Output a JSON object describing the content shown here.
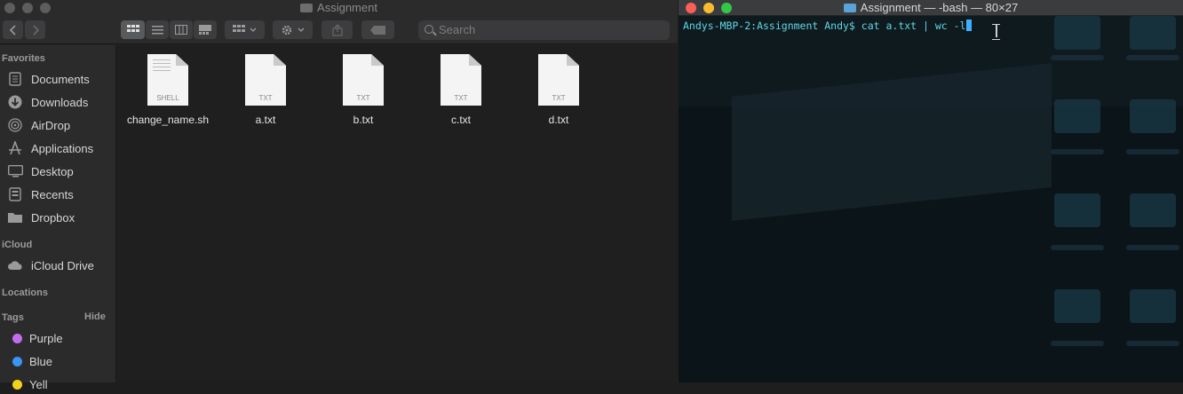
{
  "finder": {
    "title": "Assignment",
    "search_placeholder": "Search",
    "sidebar": {
      "favorites_label": "Favorites",
      "favorites": [
        {
          "label": "Documents",
          "icon": "documents-icon"
        },
        {
          "label": "Downloads",
          "icon": "downloads-icon"
        },
        {
          "label": "AirDrop",
          "icon": "airdrop-icon"
        },
        {
          "label": "Applications",
          "icon": "applications-icon"
        },
        {
          "label": "Desktop",
          "icon": "desktop-icon"
        },
        {
          "label": "Recents",
          "icon": "recents-icon"
        },
        {
          "label": "Dropbox",
          "icon": "dropbox-folder-icon"
        }
      ],
      "icloud_label": "iCloud",
      "icloud_drive": "iCloud Drive",
      "locations_label": "Locations",
      "tags_label": "Tags",
      "hide_label": "Hide",
      "tags": [
        {
          "label": "Purple",
          "color": "#c46cf0"
        },
        {
          "label": "Blue",
          "color": "#3a95f7"
        },
        {
          "label": "Yell",
          "color": "#f2d21b"
        }
      ]
    },
    "files": [
      {
        "name": "change_name.sh",
        "ext": "SHELL"
      },
      {
        "name": "a.txt",
        "ext": "TXT"
      },
      {
        "name": "b.txt",
        "ext": "TXT"
      },
      {
        "name": "c.txt",
        "ext": "TXT"
      },
      {
        "name": "d.txt",
        "ext": "TXT"
      }
    ]
  },
  "terminal": {
    "title": "Assignment — -bash — 80×27",
    "prompt": "Andys-MBP-2:Assignment Andy$ ",
    "command": "cat a.txt | wc -l"
  },
  "colors": {
    "terminal_text": "#5fd7e6",
    "cursor": "#3fb0ff",
    "traffic_close": "#fc5f57",
    "traffic_minimize": "#fdbc2e",
    "traffic_zoom": "#33c748"
  }
}
